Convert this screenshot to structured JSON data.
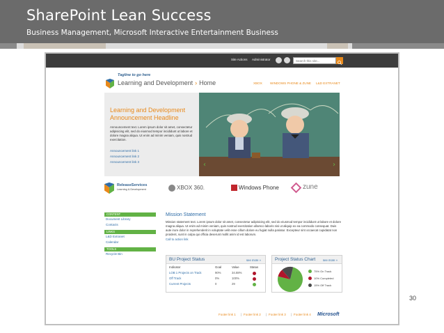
{
  "slide": {
    "title": "SharePoint Lean Success",
    "subtitle": "Business Management, Microsoft Interactive Entertainment Business",
    "page_number": "30"
  },
  "topbar": {
    "site_actions": "Site Actions",
    "user": "Administrator",
    "search_placeholder": "Search this site..."
  },
  "header": {
    "tagline": "Tagline to go here",
    "site_name": "Learning and Development",
    "current": "Home",
    "nav": [
      "XBOX",
      "WINDOWS PHONE & ZUNE",
      "L&D EXTRANET"
    ]
  },
  "hero": {
    "title": "Learning and Development Announcement Headline",
    "body": "Announcement text. Lorem ipsum dolor sit amet, consectetur adipisicing elit, sed do eiusmod tempor incididunt ut labore et dolore magna aliqua. Ut enim ad minim veniam, quis nostrud exercitation.",
    "links": [
      "Announcement link 1",
      "Announcement link 2",
      "Announcement link 3"
    ]
  },
  "partners": {
    "release": "ReleaseServices",
    "release_sub": "Learning & Development",
    "xbox": "XBOX 360.",
    "winphone": "Windows Phone",
    "zune": "zune"
  },
  "sidebar": {
    "sections": [
      {
        "head": "CONTENT",
        "items": [
          "Document Library",
          "Contacts"
        ]
      },
      {
        "head": "LINKS",
        "items": [
          "L&D Extranet",
          "Calendar"
        ]
      },
      {
        "head": "TOOLS",
        "items": [
          "Recycle Bin"
        ]
      }
    ]
  },
  "mission": {
    "title": "Mission Statement",
    "body": "Mission statement text. Lorem ipsum dolor sit amet, consectetur adipisicing elit, sed do eiusmod tempor incididunt ut labore et dolore magna aliqua. Ut enim ad minim veniam, quis nostrud exercitation ullamco laboris nisi ut aliquip ex ea commodo consequat. Duis aute irure dolor in reprehenderit in voluptate velit esse cillum dolore eu fugiat nulla pariatur. Excepteur sint occaecat cupidatat non proident, sunt in culpa qui officia deserunt mollit anim id est laborum.",
    "link": "Call to action link"
  },
  "project_status": {
    "title": "BU Project Status",
    "more": "see more »",
    "columns": [
      "Indicator",
      "Goal",
      "Value",
      "Status"
    ],
    "rows": [
      {
        "indicator": "LOB 1 Projects on Track",
        "goal": "90%",
        "value": "34.88%",
        "status_color": "#b0152b"
      },
      {
        "indicator": "Off Track",
        "goal": "0%",
        "value": "100%",
        "status_color": "#b0152b"
      },
      {
        "indicator": "Current Projects",
        "goal": "0",
        "value": "29",
        "status_color": "#62b245"
      }
    ]
  },
  "status_chart": {
    "title": "Project Status Chart",
    "more": "see more »",
    "legend": [
      {
        "label": "75% On Track",
        "color": "#62b245"
      },
      {
        "label": "10% Completed",
        "color": "#b0152b"
      },
      {
        "label": "15% Off Track",
        "color": "#4a4a4a"
      }
    ],
    "slices": [
      75,
      10,
      15
    ]
  },
  "footer": {
    "links": [
      "Footer link 1",
      "Footer link 2",
      "Footer link 3",
      "Footer link 4"
    ],
    "brand": "Microsoft"
  }
}
